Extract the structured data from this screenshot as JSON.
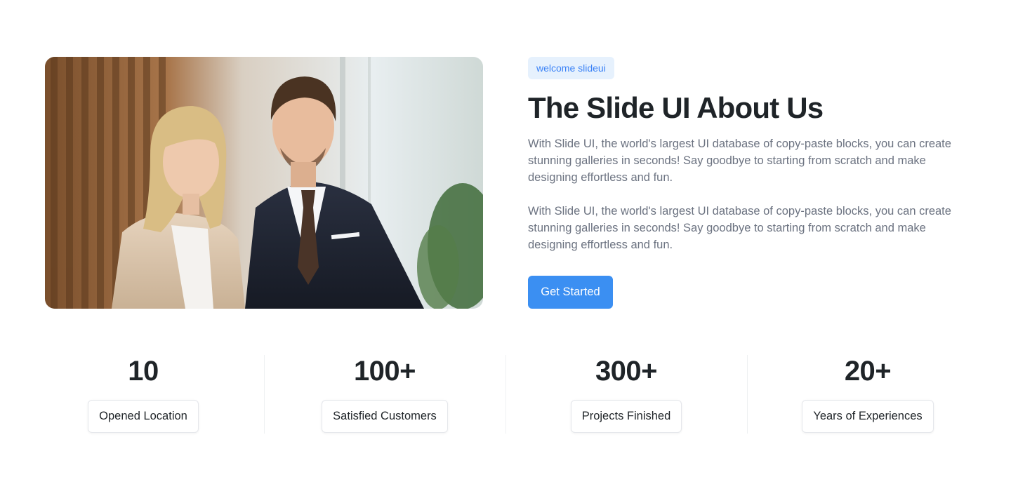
{
  "hero": {
    "image_alt": "Two business professionals smiling in an office",
    "badge": "welcome slideui",
    "title": "The Slide UI About Us",
    "paragraphs": [
      "With Slide UI, the world's largest UI database of copy-paste blocks, you can create stunning galleries in seconds! Say goodbye to starting from scratch and make designing effortless and fun.",
      "With Slide UI, the world's largest UI database of copy-paste blocks, you can create stunning galleries in seconds! Say goodbye to starting from scratch and make designing effortless and fun."
    ],
    "cta_label": "Get Started"
  },
  "stats": [
    {
      "value": "10",
      "label": "Opened Location"
    },
    {
      "value": "100+",
      "label": "Satisfied Customers"
    },
    {
      "value": "300+",
      "label": "Projects Finished"
    },
    {
      "value": "20+",
      "label": "Years of Experiences"
    }
  ],
  "colors": {
    "accent": "#3b8ff2",
    "badge_bg": "#e6f1fd",
    "badge_text": "#3b82f6",
    "heading": "#1f2428",
    "body_text": "#6b7280"
  }
}
